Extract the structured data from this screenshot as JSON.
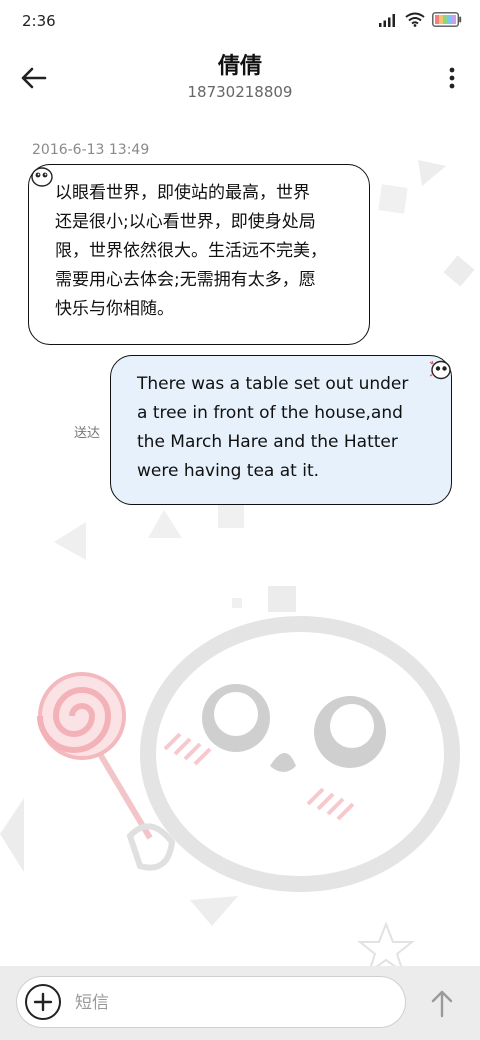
{
  "status_bar": {
    "time": "2:36",
    "icons": [
      "signal-icon",
      "wifi-icon",
      "battery-icon"
    ]
  },
  "header": {
    "contact_name": "倩倩",
    "phone_number": "18730218809",
    "back_icon": "arrow-left-icon",
    "more_icon": "more-vertical-icon"
  },
  "conversation": {
    "timestamp": "2016-6-13 13:49",
    "incoming": {
      "lines": [
        "以眼看世界，即使站的最高，世界",
        "还是很小;以心看世界，即使身处局",
        "限，世界依然很大。生活远不完美，",
        "需要用心去体会;无需拥有太多，愿",
        "快乐与你相随。"
      ]
    },
    "outgoing": {
      "lines": [
        "There was a table set out under",
        "a tree in front of the house,and",
        "the March Hare and the Hatter",
        "were having tea at it."
      ],
      "status": "送达"
    }
  },
  "composer": {
    "placeholder": "短信",
    "value": "",
    "add_icon": "plus-circle-icon",
    "send_icon": "arrow-up-icon"
  },
  "colors": {
    "outgoing_bubble": "#e6f1fc",
    "incoming_bubble": "#ffffff",
    "composer_bar": "#ececec"
  }
}
